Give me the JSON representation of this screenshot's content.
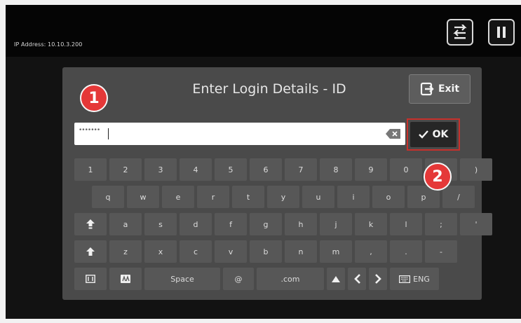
{
  "status_bar": {
    "ip_address": "IP Address: 10.10.3.200"
  },
  "dialog": {
    "title": "Enter Login Details - ID",
    "exit_label": "Exit",
    "ok_label": "OK",
    "input": {
      "masked_value": "•••••••"
    }
  },
  "keyboard": {
    "row1": [
      "1",
      "2",
      "3",
      "4",
      "5",
      "6",
      "7",
      "8",
      "9",
      "0",
      "(",
      ")"
    ],
    "row2": [
      "q",
      "w",
      "e",
      "r",
      "t",
      "y",
      "u",
      "i",
      "o",
      "p",
      "/"
    ],
    "row3": [
      "a",
      "s",
      "d",
      "f",
      "g",
      "h",
      "j",
      "k",
      "l",
      ";",
      "'"
    ],
    "row4": [
      "z",
      "x",
      "c",
      "v",
      "b",
      "n",
      "m",
      ",",
      ".",
      "-"
    ],
    "row5": {
      "space_label": "Space",
      "at_label": "@",
      "com_label": ".com",
      "lang_label": "ENG"
    }
  },
  "annotations": {
    "marker1": "1",
    "marker2": "2"
  },
  "colors": {
    "accent_red": "#e53838",
    "panel": "#4a4a4a",
    "key": "#575757"
  }
}
